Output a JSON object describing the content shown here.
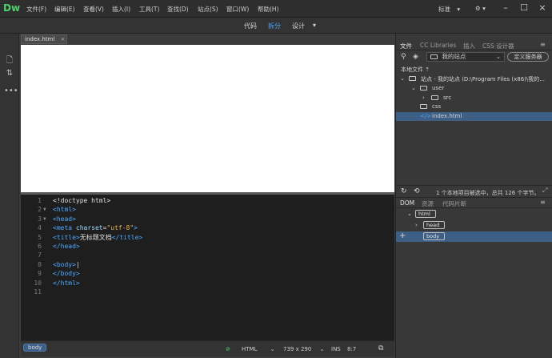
{
  "app": {
    "logo": "Dw",
    "menu": [
      "文件(F)",
      "编辑(E)",
      "查看(V)",
      "插入(I)",
      "工具(T)",
      "查找(D)",
      "站点(S)",
      "窗口(W)",
      "帮助(H)"
    ],
    "workspace": "标准",
    "workspace_arrow": "▾",
    "sync_arrow": "▾"
  },
  "viewbar": {
    "code": "代码",
    "split": "拆分",
    "design": "设计",
    "arrow": "▾"
  },
  "document": {
    "tab": "index.html",
    "close": "×"
  },
  "code": {
    "lines": [
      {
        "n": "1",
        "fold": "",
        "parts": [
          [
            "txt",
            "<!doctype html>"
          ]
        ]
      },
      {
        "n": "2",
        "fold": "▼",
        "parts": [
          [
            "tag",
            "<html>"
          ]
        ]
      },
      {
        "n": "3",
        "fold": "▼",
        "parts": [
          [
            "tag",
            "<head>"
          ]
        ]
      },
      {
        "n": "4",
        "fold": "",
        "parts": [
          [
            "tag",
            "<meta "
          ],
          [
            "attr",
            "charset"
          ],
          [
            "txt",
            "="
          ],
          [
            "str",
            "\"utf-8\""
          ],
          [
            "tag",
            ">"
          ]
        ]
      },
      {
        "n": "5",
        "fold": "",
        "parts": [
          [
            "tag",
            "<title>"
          ],
          [
            "txt",
            "无标题文档"
          ],
          [
            "tag",
            "</title>"
          ]
        ]
      },
      {
        "n": "6",
        "fold": "",
        "parts": [
          [
            "tag",
            "</head>"
          ]
        ]
      },
      {
        "n": "7",
        "fold": "",
        "parts": []
      },
      {
        "n": "8",
        "fold": "",
        "parts": [
          [
            "tag",
            "<body>"
          ],
          [
            "txt",
            "|"
          ]
        ]
      },
      {
        "n": "9",
        "fold": "",
        "parts": [
          [
            "tag",
            "</body>"
          ]
        ]
      },
      {
        "n": "10",
        "fold": "",
        "parts": [
          [
            "tag",
            "</html>"
          ]
        ]
      },
      {
        "n": "11",
        "fold": "",
        "parts": []
      }
    ]
  },
  "status": {
    "tag": "body",
    "language": "HTML",
    "size": "739 x 290",
    "mode": "INS",
    "position": "8:7"
  },
  "panel": {
    "tabs": [
      "文件",
      "CC Libraries",
      "插入",
      "CSS 设计器"
    ],
    "site": "我的站点",
    "define_server": "定义服务器",
    "local_files": "本地文件 ⇡",
    "tree": [
      {
        "label": "站点 - 我的站点 (D:\\Program Files (x86)\\我的...",
        "indent": 0,
        "arrow": "⌄"
      },
      {
        "label": "user",
        "indent": 1,
        "arrow": "⌄"
      },
      {
        "label": "src",
        "indent": 2,
        "arrow": "›"
      },
      {
        "label": "css",
        "indent": 1,
        "arrow": ""
      },
      {
        "label": "index.html",
        "indent": 1,
        "arrow": "",
        "selected": true
      }
    ],
    "status_text": "1 个本地项目被选中，总共 126 个字节。",
    "dom_tabs": [
      "DOM",
      "资源",
      "代码片断"
    ],
    "dom": [
      {
        "label": "html",
        "indent": 0,
        "arrow": "⌄"
      },
      {
        "label": "head",
        "indent": 1,
        "arrow": "›"
      },
      {
        "label": "body",
        "indent": 1,
        "arrow": "",
        "selected": true
      }
    ]
  },
  "colors": {
    "accent": "#4fa7ff",
    "logo": "#4ed16a",
    "selection": "#3d5f86"
  }
}
